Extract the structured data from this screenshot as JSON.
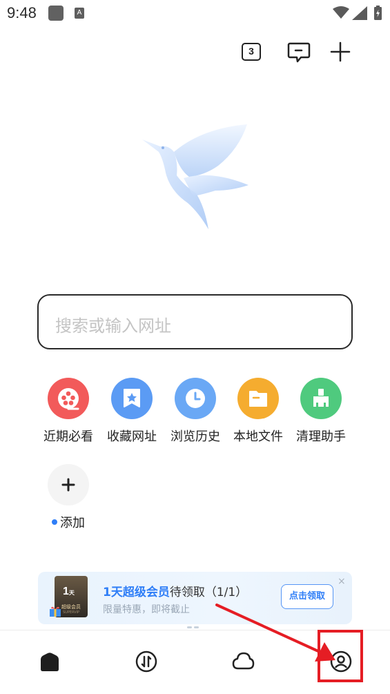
{
  "status_bar": {
    "time": "9:48",
    "notification_letter": "A"
  },
  "toolbar": {
    "tab_count": "3"
  },
  "search": {
    "placeholder": "搜索或输入网址"
  },
  "quick_links": [
    {
      "label": "近期必看",
      "icon": "film-reel-icon",
      "color": "#f25a5a"
    },
    {
      "label": "收藏网址",
      "icon": "star-bookmark-icon",
      "color": "#5b9bf4"
    },
    {
      "label": "浏览历史",
      "icon": "clock-icon",
      "color": "#6aa8f5"
    },
    {
      "label": "本地文件",
      "icon": "folder-icon",
      "color": "#f5ac2f"
    },
    {
      "label": "清理助手",
      "icon": "broom-icon",
      "color": "#4fca7e"
    },
    {
      "label": "添加",
      "icon": "plus-icon",
      "color": "#f4f4f4"
    }
  ],
  "promo": {
    "card_day": "1",
    "card_day_unit": "天",
    "card_text": "超级会员",
    "card_sub": "SUPERVIP",
    "title_highlight": "1天超级会员",
    "title_rest": "待领取（1/1）",
    "subtitle": "限量特惠，即将截止",
    "claim_button": "点击领取",
    "close_glyph": "×"
  },
  "colors": {
    "accent": "#2f7ef7",
    "annotation": "#e51d24"
  }
}
